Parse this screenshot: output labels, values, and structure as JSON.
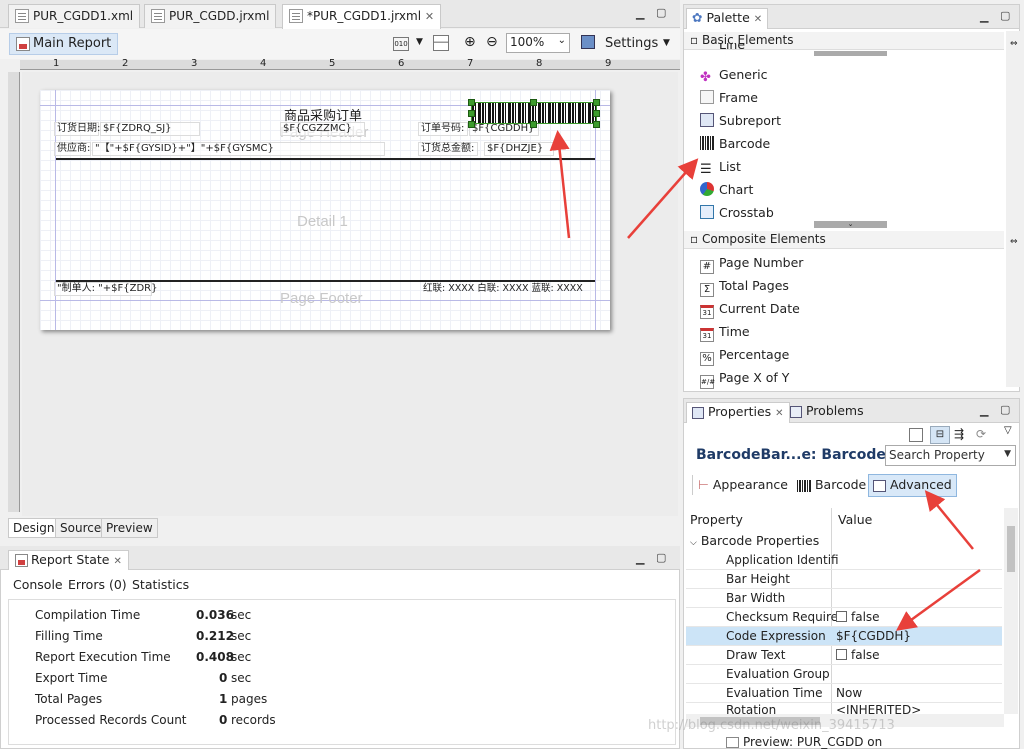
{
  "editor": {
    "tabs": [
      {
        "label": "PUR_CGDD1.xml"
      },
      {
        "label": "PUR_CGDD.jrxml"
      },
      {
        "label": "*PUR_CGDD1.jrxml"
      }
    ],
    "main_report": "Main Report",
    "zoom": "100%",
    "settings": "Settings",
    "ruler_marks": [
      "1",
      "2",
      "3",
      "4",
      "5",
      "6",
      "7",
      "8",
      "9"
    ],
    "bottom_tabs": [
      "Design",
      "Source",
      "Preview"
    ]
  },
  "report": {
    "title": "商品采购订单",
    "bands": {
      "header": "Page Header",
      "detail": "Detail 1",
      "footer": "Page Footer"
    },
    "fields": {
      "order_date_label": "订货日期:",
      "order_date_expr": "$F{ZDRQ_SJ}",
      "cgzzmc": "$F{CGZZMC}",
      "order_no_label": "订单号码:",
      "order_no_expr": "$F{CGDDH}",
      "supplier_label": "供应商:",
      "supplier_expr": "\"【\"+$F{GYSID}+\"】\"+$F{GYSMC}",
      "total_label": "订货总金额:",
      "total_expr": "$F{DHZJE}",
      "maker_expr": "\"制单人: \"+$F{ZDR}",
      "footer_note": "红联: XXXX  白联: XXXX  蓝联: XXXX"
    }
  },
  "report_state": {
    "title": "Report State",
    "tabs": [
      "Console",
      "Errors (0)",
      "Statistics"
    ],
    "stats": [
      {
        "name": "Compilation Time",
        "value": "0.036",
        "unit": "sec"
      },
      {
        "name": "Filling Time",
        "value": "0.212",
        "unit": "sec"
      },
      {
        "name": "Report Execution Time",
        "value": "0.408",
        "unit": "sec"
      },
      {
        "name": "Export Time",
        "value": "0",
        "unit": "sec"
      },
      {
        "name": "Total Pages",
        "value": "1",
        "unit": "pages"
      },
      {
        "name": "Processed Records Count",
        "value": "0",
        "unit": "records"
      }
    ]
  },
  "palette": {
    "title": "Palette",
    "basic_title": "Basic Elements",
    "basic_items": [
      "Line",
      "Generic",
      "Frame",
      "Subreport",
      "Barcode",
      "List",
      "Chart",
      "Crosstab"
    ],
    "composite_title": "Composite Elements",
    "composite_items": [
      "Page Number",
      "Total Pages",
      "Current Date",
      "Time",
      "Percentage",
      "Page X of Y"
    ]
  },
  "properties": {
    "tab_properties": "Properties",
    "tab_problems": "Problems",
    "element_title": "BarcodeBar...e: Barcode",
    "search_placeholder": "Search Property",
    "subtabs": [
      "Appearance",
      "Barcode",
      "Advanced"
    ],
    "col_property": "Property",
    "col_value": "Value",
    "group": "Barcode Properties",
    "rows": [
      {
        "name": "Application Identifi",
        "value": ""
      },
      {
        "name": "Bar Height",
        "value": ""
      },
      {
        "name": "Bar Width",
        "value": ""
      },
      {
        "name": "Checksum Require",
        "value": "false"
      },
      {
        "name": "Code Expression",
        "value": "$F{CGDDH}"
      },
      {
        "name": "Draw Text",
        "value": "false"
      },
      {
        "name": "Evaluation Group",
        "value": ""
      },
      {
        "name": "Evaluation Time",
        "value": "Now"
      },
      {
        "name": "Rotation",
        "value": "<INHERITED>"
      }
    ]
  },
  "status": {
    "preview": "Preview: PUR_CGDD on"
  },
  "watermark": "http://blog.csdn.net/weixin_39415713",
  "colors": {
    "selected_row": "#cce4f7",
    "arrow": "#e8403a",
    "handle": "#3c9b2c"
  }
}
